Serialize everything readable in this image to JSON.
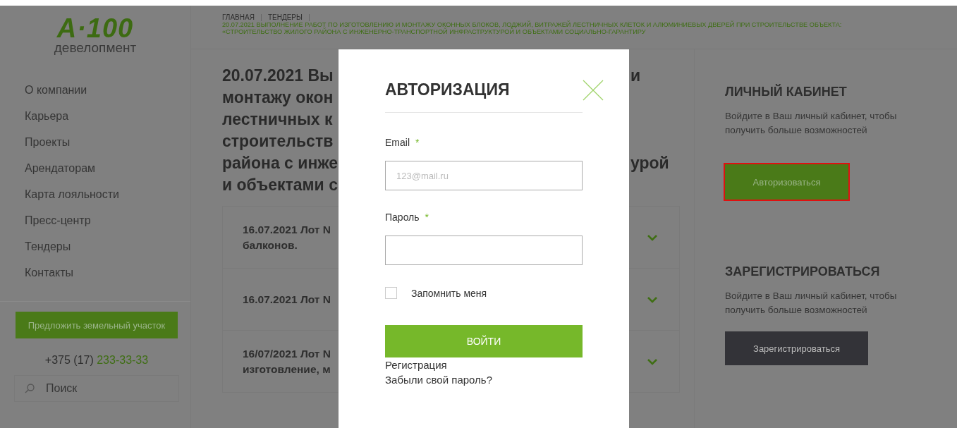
{
  "logo": {
    "mark": "А·100",
    "subtitle": "девелопмент"
  },
  "sidebar": {
    "items": [
      {
        "label": "О компании"
      },
      {
        "label": "Карьера"
      },
      {
        "label": "Проекты"
      },
      {
        "label": "Арендаторам"
      },
      {
        "label": "Карта лояльности"
      },
      {
        "label": "Пресс-центр"
      },
      {
        "label": "Тендеры"
      },
      {
        "label": "Контакты"
      }
    ],
    "cta": "Предложить земельный участок",
    "phone": {
      "code": "+375 (17)",
      "number": "233-33-33"
    },
    "search": {
      "placeholder": "Поиск"
    }
  },
  "breadcrumbs": [
    {
      "label": "ГЛАВНАЯ"
    },
    {
      "label": "ТЕНДЕРЫ"
    }
  ],
  "breadcrumb_current": [
    "20.07.2021 ВЫПОЛНЕНИЕ РАБОТ ПО ИЗГОТОВЛЕНИЮ И МОНТАЖУ ОКОННЫХ БЛОКОВ, ЛОДЖИЙ, ВИТРАЖЕЙ ЛЕСТНИЧНЫХ КЛЕТОК И АЛЮМИНИЕВЫХ ДВЕРЕЙ ПРИ СТРОИТЕЛЬСТВЕ ОБЪЕКТА:",
    "«СТРОИТЕЛЬСТВО ЖИЛОГО РАЙОНА С ИНЖЕНЕРНО-ТРАНСПОРТНОЙ ИНФРАСТРУКТУРОЙ И ОБЪЕКТАМИ СОЦИАЛЬНО-ГАРАНТИРУ"
  ],
  "title_lines": [
    {
      "left": "20.07.2021 Вы",
      "right": "и"
    },
    {
      "left": "монтажу окон"
    },
    {
      "left": "лестничных к"
    },
    {
      "left": "строительств"
    },
    {
      "left": "района с инже",
      "right": "урой"
    },
    {
      "left": "и объектами с"
    }
  ],
  "lots": [
    {
      "lines": [
        "16.07.2021 Лот N",
        "балконов."
      ]
    },
    {
      "lines": [
        "16.07.2021 Лот N"
      ]
    },
    {
      "lines": [
        "16/07/2021 Лот N",
        "изготовление, м"
      ]
    }
  ],
  "modal": {
    "title": "АВТОРИЗАЦИЯ",
    "fields": [
      {
        "label": "Email",
        "marker": "*",
        "placeholder": "123@mail.ru"
      },
      {
        "label": "Пароль",
        "marker": "*"
      }
    ],
    "remember": {
      "label": "Запомнить меня",
      "checked": false
    },
    "submit": "ВОЙТИ",
    "links": [
      "Регистрация",
      "Забыли свой пароль?"
    ]
  },
  "account": [
    {
      "kind": "primary",
      "title": "ЛИЧНЫЙ КАБИНЕТ",
      "text": "Войдите в Ваш личный кабинет, чтобы получить больше возможностей",
      "button": "Авторизоваться",
      "highlighted": true
    },
    {
      "kind": "dark",
      "title": "ЗАРЕГИСТРИРОВАТЬСЯ",
      "text": "Войдите в Ваш личный кабинет, чтобы получить больше возможностей",
      "button": "Зарегистрироваться",
      "highlighted": false
    }
  ]
}
